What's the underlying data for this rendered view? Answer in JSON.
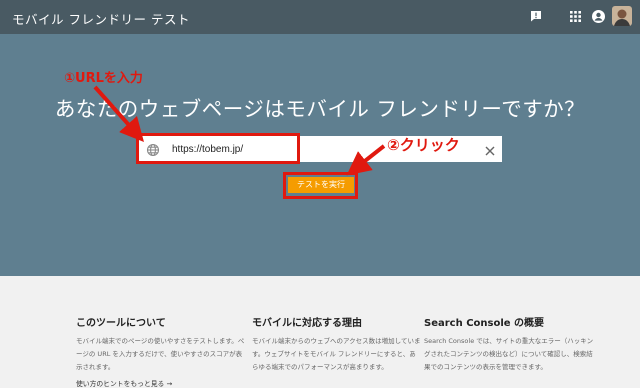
{
  "app": {
    "title": "モバイル フレンドリー テスト"
  },
  "toolbar": {
    "icons": [
      "feedback-icon",
      "apps-grid-icon",
      "account-icon",
      "avatar"
    ]
  },
  "hero": {
    "headline": "あなたのウェブページはモバイル フレンドリーですか？"
  },
  "url_input": {
    "value": "https://tobem.jp/"
  },
  "run_button": {
    "label": "テストを実行"
  },
  "annotations": {
    "step1": "①URLを入力",
    "step2": "②クリック",
    "color": "#e0190f"
  },
  "info": {
    "col1": {
      "title": "このツールについて",
      "body": "モバイル端末でのページの使いやすさをテストします。ページの URL を入力するだけで、使いやすさのスコアが表示されます。",
      "link": "使い方のヒントをもっと見る →"
    },
    "col2": {
      "title": "モバイルに対応する理由",
      "body": "モバイル端末からのウェブへのアクセス数は増加しています。ウェブサイトをモバイル フレンドリーにすると、あらゆる端末でのパフォーマンスが高まります。"
    },
    "col3": {
      "title": "Search Console の概要",
      "body": "Search Console では、サイトの重大なエラー（ハッキングされたコンテンツの検出など）について確認し、検索結果でのコンテンツの表示を管理できます。"
    }
  },
  "colors": {
    "topbar": "#495a63",
    "hero": "#5f7f90",
    "button": "#f59c00"
  }
}
